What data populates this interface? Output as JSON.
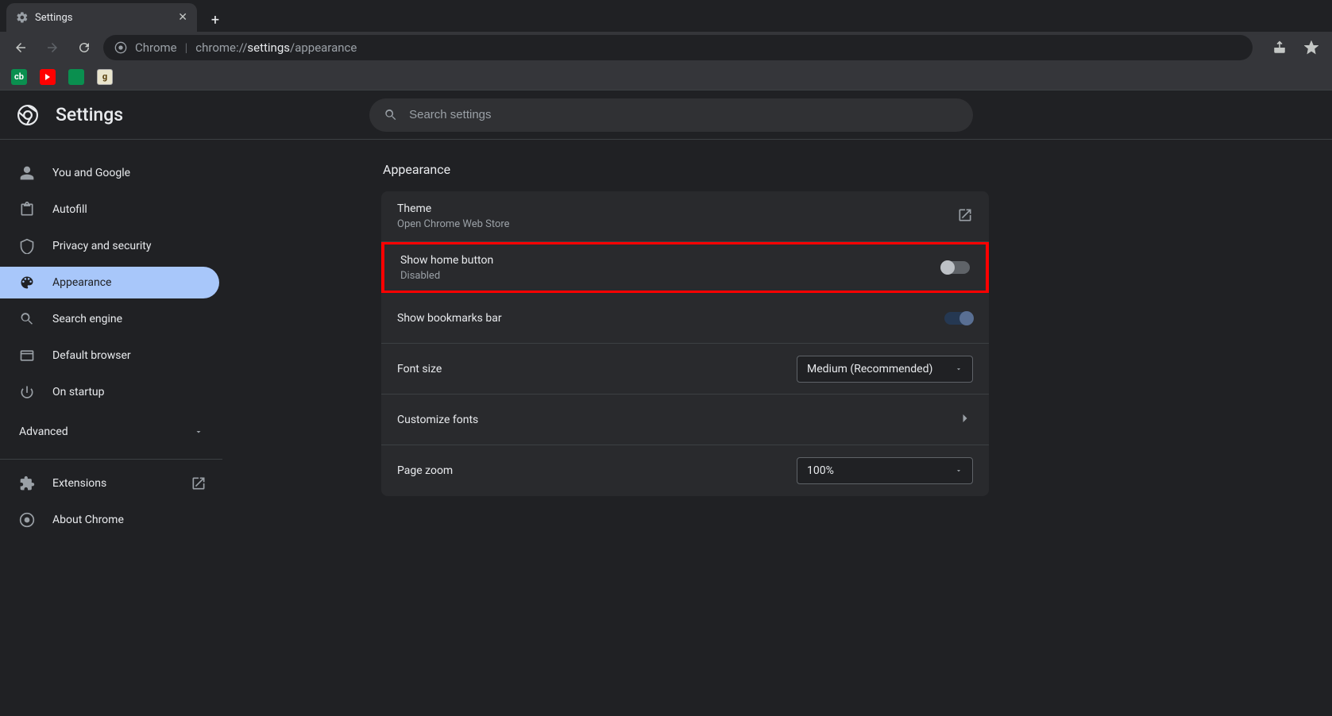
{
  "tab": {
    "title": "Settings"
  },
  "omnibox": {
    "origin_label": "Chrome",
    "url_prefix": "chrome://",
    "url_emph": "settings",
    "url_suffix": "/appearance"
  },
  "header": {
    "title": "Settings",
    "search_placeholder": "Search settings"
  },
  "sidebar": {
    "items": [
      {
        "label": "You and Google"
      },
      {
        "label": "Autofill"
      },
      {
        "label": "Privacy and security"
      },
      {
        "label": "Appearance"
      },
      {
        "label": "Search engine"
      },
      {
        "label": "Default browser"
      },
      {
        "label": "On startup"
      }
    ],
    "advanced": "Advanced",
    "footer": [
      {
        "label": "Extensions"
      },
      {
        "label": "About Chrome"
      }
    ]
  },
  "main": {
    "section_title": "Appearance",
    "rows": {
      "theme": {
        "primary": "Theme",
        "secondary": "Open Chrome Web Store"
      },
      "home": {
        "primary": "Show home button",
        "secondary": "Disabled",
        "on": false
      },
      "bookmarks": {
        "primary": "Show bookmarks bar",
        "on": true
      },
      "fontsize": {
        "primary": "Font size",
        "value": "Medium (Recommended)"
      },
      "customfonts": {
        "primary": "Customize fonts"
      },
      "zoom": {
        "primary": "Page zoom",
        "value": "100%"
      }
    }
  }
}
